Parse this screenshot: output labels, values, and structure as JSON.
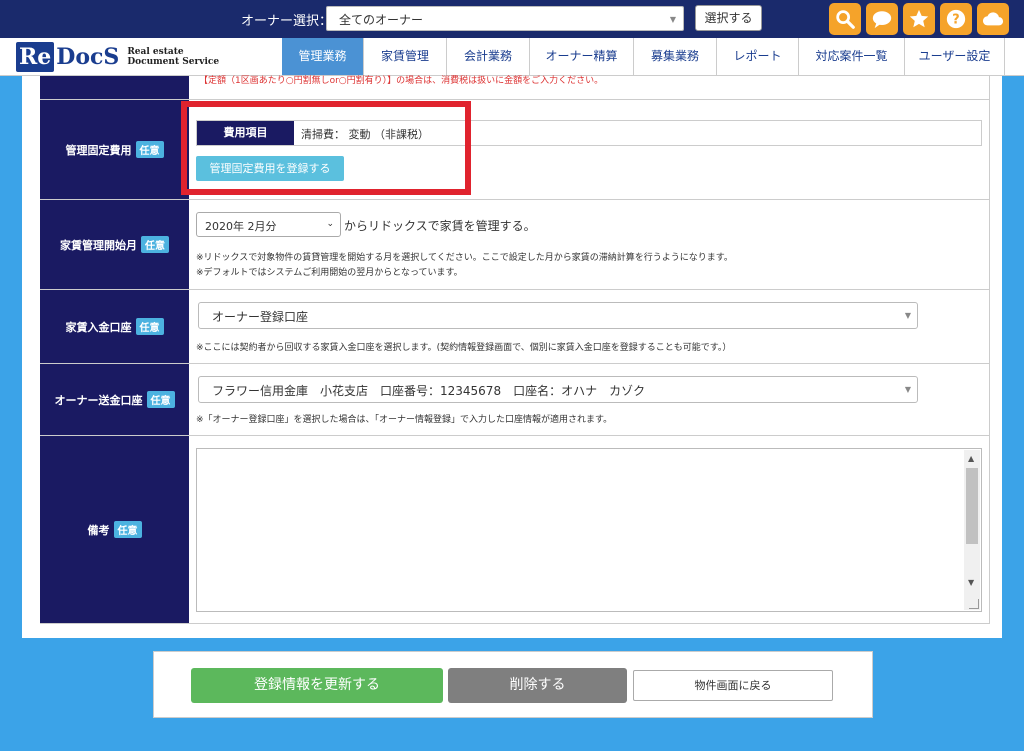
{
  "topbar": {
    "owner_label": "オーナー選択：",
    "owner_value": "全てのオーナー",
    "select_button": "選択する",
    "icons": [
      "search-icon",
      "chat-icon",
      "star-icon",
      "help-icon",
      "cloud-icon"
    ],
    "icon_color": "#f5a32a",
    "bg_color": "#1a2a6c"
  },
  "logo": {
    "re": "Re",
    "docs": "DocS",
    "line1": "Real estate",
    "line2": "Document Service"
  },
  "nav": {
    "tabs": [
      {
        "label": "管理業務",
        "active": true
      },
      {
        "label": "家賃管理",
        "active": false
      },
      {
        "label": "会計業務",
        "active": false
      },
      {
        "label": "オーナー精算",
        "active": false
      },
      {
        "label": "募集業務",
        "active": false
      },
      {
        "label": "レポート",
        "active": false
      },
      {
        "label": "対応案件一覧",
        "active": false
      },
      {
        "label": "ユーザー設定",
        "active": false
      }
    ]
  },
  "form": {
    "optional_badge": "任意",
    "top_warning": "【定額（1区画あたり○円割無しor○円割有り）】の場合は、消費税は扱いに金額をご入力ください。",
    "fixed_fee": {
      "label": "管理固定費用",
      "item_header": "費用項目",
      "item_value": "清掃費： 変動 （非課税）",
      "register_button": "管理固定費用を登録する"
    },
    "start_month": {
      "label": "家賃管理開始月",
      "value": "2020年 2月分",
      "after_text": "からリドックスで家賃を管理する。",
      "note1": "※リドックスで対象物件の賃貸管理を開始する月を選択してください。ここで設定した月から家賃の滞納計算を行うようになります。",
      "note2": "※デフォルトではシステムご利用開始の翌月からとなっています。"
    },
    "rent_account": {
      "label": "家賃入金口座",
      "value": "オーナー登録口座",
      "note": "※ここには契約者から回収する家賃入金口座を選択します。(契約情報登録画面で、個別に家賃入金口座を登録することも可能です。）"
    },
    "owner_account": {
      "label": "オーナー送金口座",
      "value": "フラワー信用金庫　小花支店　口座番号：12345678　口座名：オハナ　カゾク",
      "note": "※「オーナー登録口座」を選択した場合は、「オーナー情報登録」で入力した口座情報が適用されます。"
    },
    "remarks": {
      "label": "備考",
      "value": ""
    }
  },
  "actions": {
    "update": "登録情報を更新する",
    "delete": "削除する",
    "back": "物件画面に戻る"
  }
}
